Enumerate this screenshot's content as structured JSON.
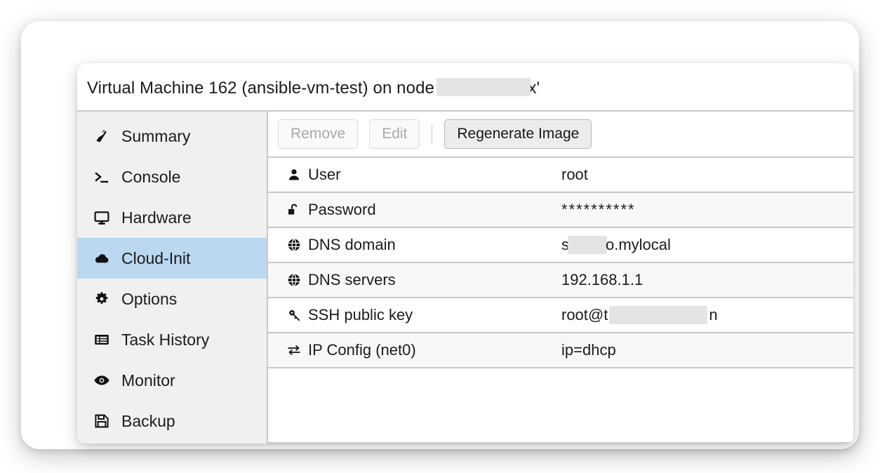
{
  "window": {
    "title_prefix": "Virtual Machine 162 (ansible-vm-test) on node '",
    "title_suffix": "x'"
  },
  "sidebar": {
    "items": [
      {
        "label": "Summary",
        "icon": "book-icon",
        "selected": false
      },
      {
        "label": "Console",
        "icon": "terminal-icon",
        "selected": false
      },
      {
        "label": "Hardware",
        "icon": "monitor-icon",
        "selected": false
      },
      {
        "label": "Cloud-Init",
        "icon": "cloud-icon",
        "selected": true
      },
      {
        "label": "Options",
        "icon": "gear-icon",
        "selected": false
      },
      {
        "label": "Task History",
        "icon": "list-icon",
        "selected": false
      },
      {
        "label": "Monitor",
        "icon": "eye-icon",
        "selected": false
      },
      {
        "label": "Backup",
        "icon": "floppy-icon",
        "selected": false
      }
    ]
  },
  "toolbar": {
    "remove_label": "Remove",
    "edit_label": "Edit",
    "regenerate_label": "Regenerate Image"
  },
  "properties": [
    {
      "key": "User",
      "icon": "user-icon",
      "value": "root"
    },
    {
      "key": "Password",
      "icon": "unlock-icon",
      "value": "**********"
    },
    {
      "key": "DNS domain",
      "icon": "globe-icon",
      "value_before": "s",
      "value_after": "o.mylocal",
      "redacted": true
    },
    {
      "key": "DNS servers",
      "icon": "globe-icon",
      "value": "192.168.1.1"
    },
    {
      "key": "SSH public key",
      "icon": "key-icon",
      "value_before": "root@t",
      "value_after": "n",
      "redacted": true
    },
    {
      "key": "IP Config (net0)",
      "icon": "exchange-icon",
      "value": "ip=dhcp"
    }
  ],
  "colors": {
    "selection": "#bcd8f0",
    "sidebar_bg": "#f0f0f0",
    "border": "#c8c8c8",
    "redaction": "#e4e4e4"
  }
}
